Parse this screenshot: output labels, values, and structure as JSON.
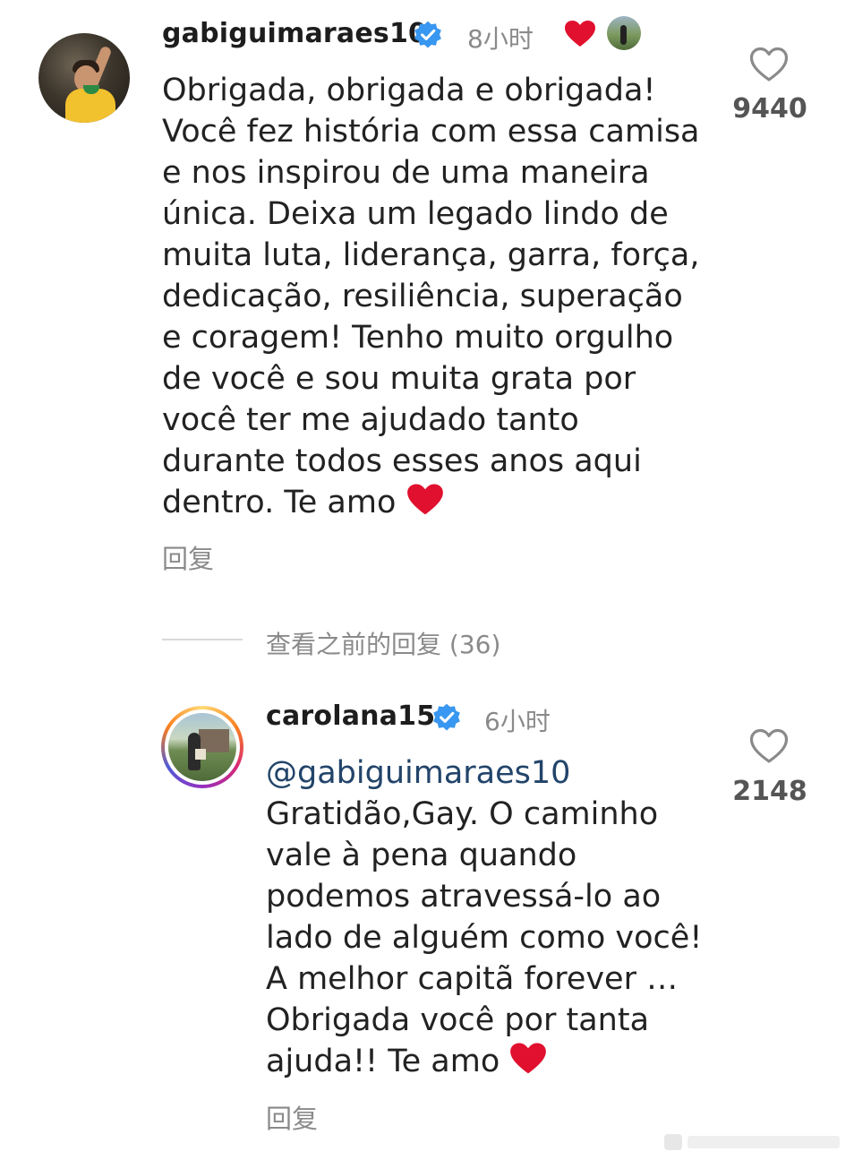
{
  "comment1": {
    "username": "gabiguimaraes10",
    "time": "8小时",
    "text": "Obrigada, obrigada e obrigada! Você fez história com essa camisa e nos inspirou de uma maneira única. Deixa um legado lindo de muita luta, liderança, garra, força, dedicação, resiliência, superação e coragem! Tenho muito orgulho de você e sou muita grata por você ter me ajudado tanto durante todos esses anos aqui dentro. Te amo",
    "lines": [
      "Obrigada, obrigada e obrigada!",
      "Você fez história com essa camisa",
      "e nos inspirou de uma maneira",
      "única. Deixa um legado lindo de",
      "muita luta, liderança, garra, força,",
      "dedicação, resiliência, superação",
      "e coragem! Tenho muito orgulho",
      "de você e sou muita grata por",
      "você ter me ajudado tanto",
      "durante todos esses anos aqui",
      "dentro. Te amo"
    ],
    "reply_label": "回复",
    "like_count": "9440"
  },
  "view_replies": {
    "label": "查看之前的回复 (36)"
  },
  "comment2": {
    "username": "carolana15",
    "time": "6小时",
    "mention": "@gabiguimaraes10",
    "lines": [
      "Gratidão,Gay. O caminho",
      "vale à pena quando",
      "podemos atravessá-lo ao",
      "lado de alguém como você!",
      "A melhor capitã forever …",
      "Obrigada você por tanta",
      "ajuda!! Te amo"
    ],
    "reply_label": "回复",
    "like_count": "2148"
  },
  "colors": {
    "verified_blue": "#3897f0",
    "heart_red": "#e0102e",
    "muted_text": "#8a8a8a"
  }
}
